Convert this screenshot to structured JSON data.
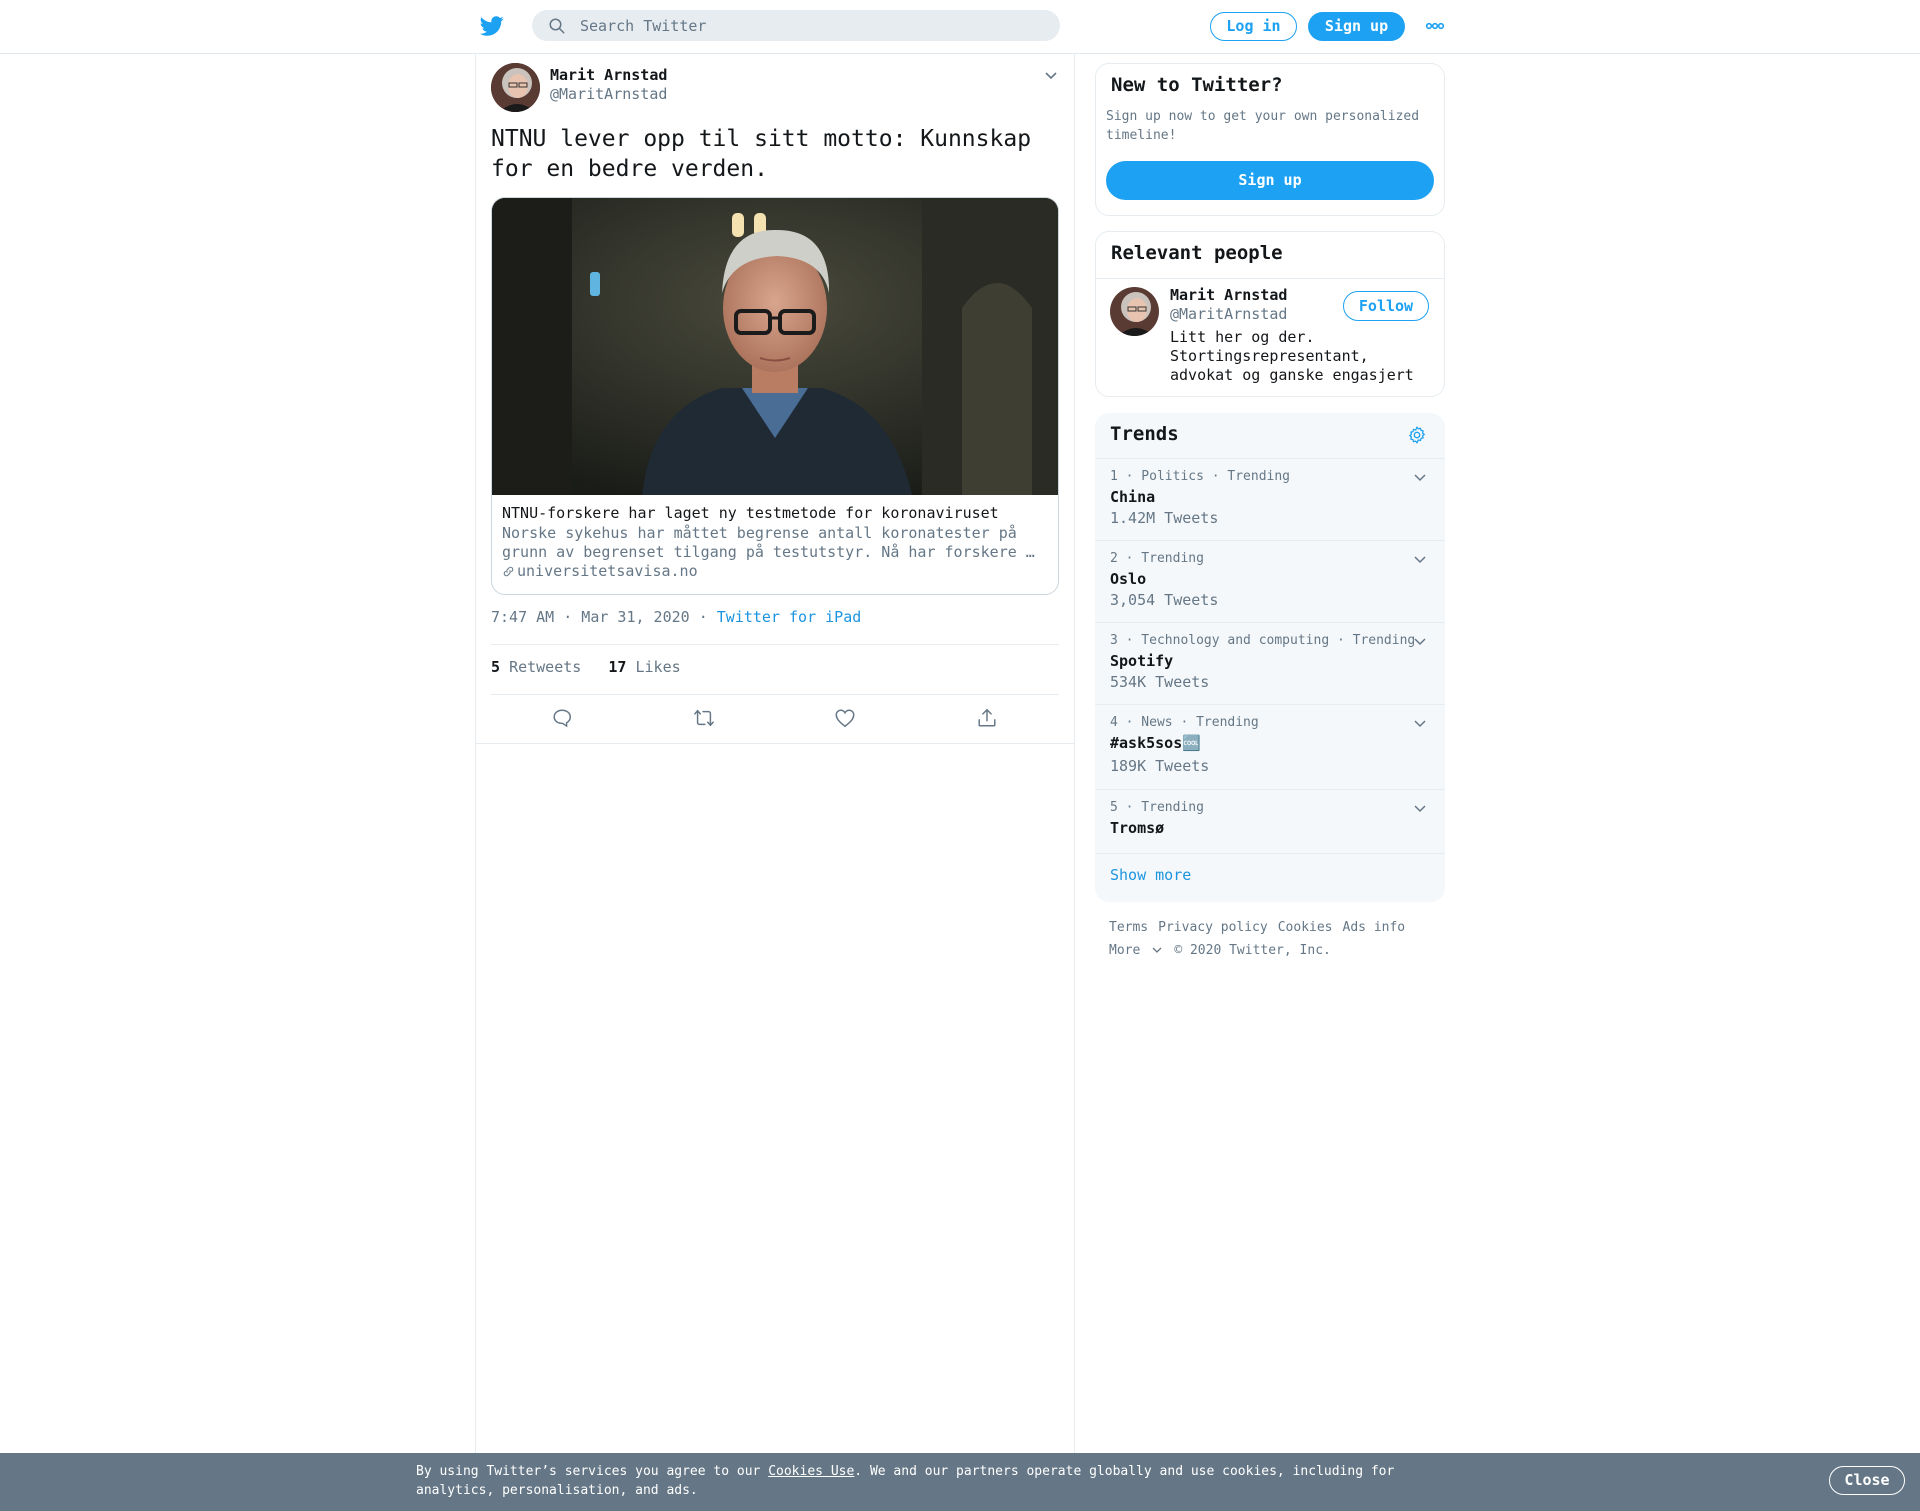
{
  "header": {
    "search_placeholder": "Search Twitter",
    "login_label": "Log in",
    "signup_label": "Sign up",
    "more_icon": "more-dots-icon",
    "logo_icon": "twitter-bird-icon"
  },
  "tweet": {
    "author_name": "Marit Arnstad",
    "author_handle": "@MaritArnstad",
    "text": "NTNU lever opp til sitt motto: Kunnskap for en bedre verden.",
    "card": {
      "title": "NTNU-forskere har laget ny testmetode for koronaviruset",
      "description": "Norske sykehus har måttet begrense antall koronatester på grunn av begrenset tilgang på testutstyr. Nå har forskere …",
      "domain": "universitetsavisa.no"
    },
    "timestamp": "7:47 AM · Mar 31, 2020",
    "separator": "·",
    "source": "Twitter for iPad",
    "retweets_count": "5",
    "retweets_label": "Retweets",
    "likes_count": "17",
    "likes_label": "Likes"
  },
  "sidebar": {
    "new_to_twitter": {
      "heading": "New to Twitter?",
      "text": "Sign up now to get your own personalized timeline!",
      "button": "Sign up"
    },
    "relevant_people": {
      "heading": "Relevant people",
      "person": {
        "name": "Marit Arnstad",
        "handle": "@MaritArnstad",
        "bio": "Litt her og der. Stortingsrepresentant, advokat og ganske engasjert",
        "follow_label": "Follow"
      }
    },
    "trends": {
      "heading": "Trends",
      "items": [
        {
          "meta": "1 · Politics · Trending",
          "name": "China",
          "count": "1.42M Tweets"
        },
        {
          "meta": "2 · Trending",
          "name": "Oslo",
          "count": "3,054 Tweets"
        },
        {
          "meta": "3 · Technology and computing · Trending",
          "name": "Spotify",
          "count": "534K Tweets"
        },
        {
          "meta": "4 · News · Trending",
          "name": "#ask5sos🆒",
          "count": "189K Tweets"
        },
        {
          "meta": "5 · Trending",
          "name": "Tromsø",
          "count": ""
        }
      ],
      "show_more": "Show more"
    },
    "footer": {
      "links": [
        "Terms",
        "Privacy policy",
        "Cookies",
        "Ads info"
      ],
      "more": "More",
      "copyright": "© 2020 Twitter, Inc."
    }
  },
  "cookie_bar": {
    "text_before": "By using Twitter’s services you agree to our ",
    "link": "Cookies Use",
    "text_after": ". We and our partners operate globally and use cookies, including for analytics, personalisation, and ads.",
    "close_label": "Close"
  },
  "colors": {
    "brand_blue": "#1da1f2",
    "link_blue": "#1b95e0",
    "secondary_text": "#657786",
    "border": "#e6ecf0",
    "cookie_bg": "#657786"
  }
}
